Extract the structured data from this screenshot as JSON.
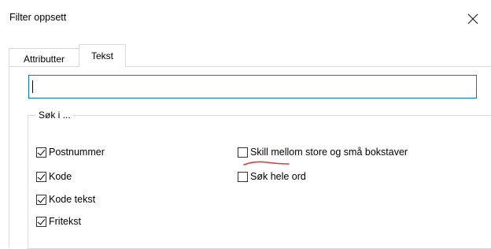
{
  "window": {
    "title": "Filter oppsett",
    "close_label": "Close"
  },
  "tabs": [
    {
      "label": "Attributter",
      "active": false
    },
    {
      "label": "Tekst",
      "active": true
    }
  ],
  "search": {
    "value": ""
  },
  "group": {
    "legend": "Søk i ...",
    "left_options": [
      {
        "label": "Postnummer",
        "checked": true
      },
      {
        "label": "Kode",
        "checked": true
      },
      {
        "label": "Kode tekst",
        "checked": true
      },
      {
        "label": "Fritekst",
        "checked": true
      }
    ],
    "right_options": [
      {
        "label": "Skill mellom store og små bokstaver",
        "checked": false
      },
      {
        "label": "Søk hele ord",
        "checked": false
      }
    ]
  },
  "colors": {
    "focus_border": "#0078d7",
    "annotation": "#e03a3a"
  }
}
